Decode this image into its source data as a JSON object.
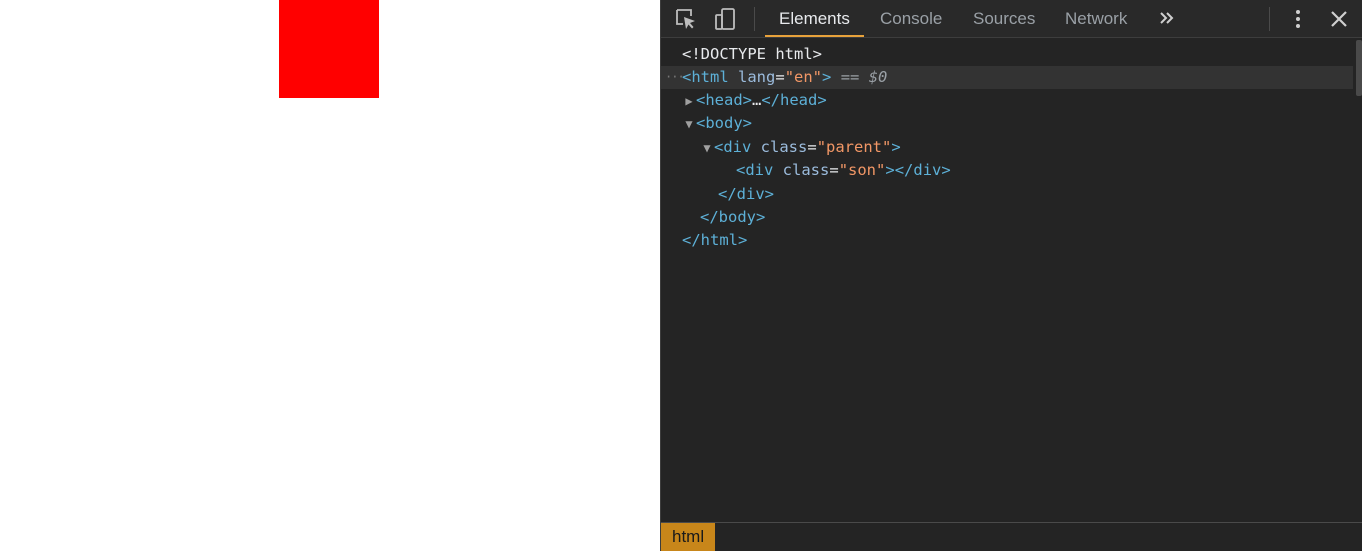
{
  "devtools": {
    "tabs": [
      {
        "label": "Elements",
        "active": true
      },
      {
        "label": "Console",
        "active": false
      },
      {
        "label": "Sources",
        "active": false
      },
      {
        "label": "Network",
        "active": false
      }
    ],
    "more_tabs_icon": "chevron-double-right-icon",
    "menu_icon": "vertical-ellipsis-icon",
    "close_icon": "close-icon",
    "inspect_icon": "inspect-element-icon",
    "device_icon": "device-toolbar-icon",
    "accent_color": "#e8a23b",
    "dom": {
      "doctype": "<!DOCTYPE html>",
      "html_open_tag": "<html",
      "html_lang_attr": "lang",
      "html_lang_val": "\"en\"",
      "html_close_bracket": ">",
      "selection_marker": " == ",
      "selection_var": "$0",
      "head_open": "<head>",
      "head_ellipsis": "…",
      "head_close": "</head>",
      "body_open": "<body>",
      "div_open": "<div",
      "class_attr": "class",
      "parent_val": "\"parent\"",
      "son_val": "\"son\"",
      "bracket_close": ">",
      "div_close": "</div>",
      "body_close": "</body>",
      "html_close": "</html>"
    },
    "breadcrumb": "html"
  },
  "page": {
    "box_color": "#ff0000"
  }
}
